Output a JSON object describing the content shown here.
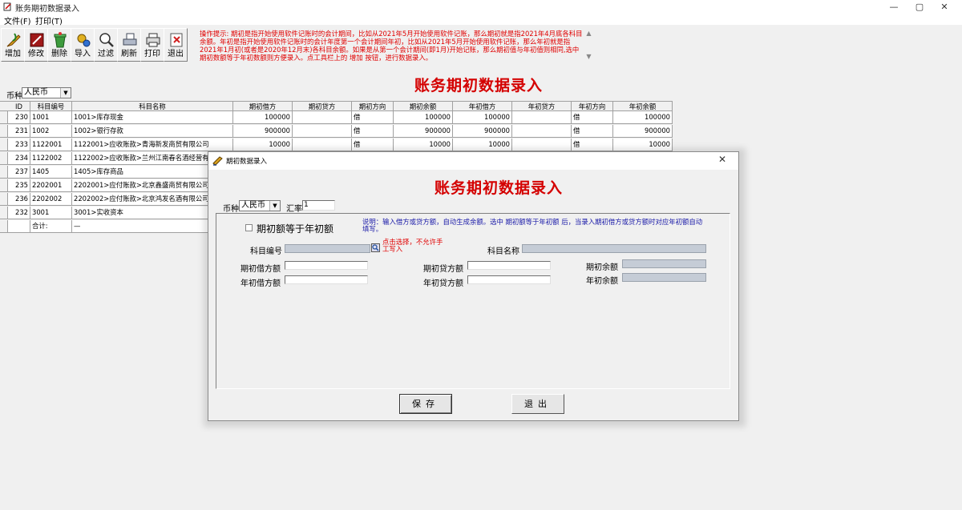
{
  "window": {
    "title": "账务期初数据录入",
    "controls": [
      "—",
      "▢",
      "✕"
    ]
  },
  "menu": [
    {
      "label": "文件(F)"
    },
    {
      "label": "打印(T)"
    }
  ],
  "toolbar": [
    {
      "label": "增加",
      "icon": "add-icon"
    },
    {
      "label": "修改",
      "icon": "edit-icon"
    },
    {
      "label": "删除",
      "icon": "delete-icon"
    },
    {
      "label": "导入",
      "icon": "import-icon"
    },
    {
      "label": "过滤",
      "icon": "filter-icon"
    },
    {
      "label": "刷新",
      "icon": "refresh-icon"
    },
    {
      "label": "打印",
      "icon": "print-icon"
    },
    {
      "label": "退出",
      "icon": "exit-icon"
    }
  ],
  "notice": "操作提示: 期初是指开始使用软件记账时的会计期间，比如从2021年5月开始使用软件记账，那么期初就是指2021年4月底各科目余额。年初是指开始使用软件记账时的会计年度第一个会计期间年初，比如从2021年5月开始使用软件记账，那么年初就是指2021年1月初(或者是2020年12月末)各科目余额。如果是从第一个会计期间(即1月)开始记账，那么期初值与年初值则相同,选中期初数额等于年初数额则方便录入。点工具栏上的 增加 按钮，进行数据录入。",
  "main_title": "账务期初数据录入",
  "currency": {
    "label": "币种",
    "value": "人民币"
  },
  "table": {
    "columns": [
      "ID",
      "科目编号",
      "科目名称",
      "期初借方",
      "期初贷方",
      "期初方向",
      "期初余额",
      "年初借方",
      "年初贷方",
      "年初方向",
      "年初余额"
    ],
    "rows": [
      [
        "230",
        "1001",
        "1001>库存现金",
        "100000",
        "",
        "借",
        "100000",
        "100000",
        "",
        "借",
        "100000"
      ],
      [
        "231",
        "1002",
        "1002>银行存款",
        "900000",
        "",
        "借",
        "900000",
        "900000",
        "",
        "借",
        "900000"
      ],
      [
        "233",
        "1122001",
        "1122001>应收账款>青海新发商贸有限公司",
        "10000",
        "",
        "借",
        "10000",
        "10000",
        "",
        "借",
        "10000"
      ],
      [
        "234",
        "1122002",
        "1122002>应收账款>兰州江南春名酒经营有限",
        "",
        "",
        "",
        "",
        "",
        "",
        "",
        ""
      ],
      [
        "237",
        "1405",
        "1405>库存商品",
        "",
        "",
        "",
        "",
        "",
        "",
        "",
        ""
      ],
      [
        "235",
        "2202001",
        "2202001>应付账款>北京鑫盛商贸有限公司",
        "",
        "",
        "",
        "",
        "",
        "",
        "",
        ""
      ],
      [
        "236",
        "2202002",
        "2202002>应付账款>北京鸿发名酒有限公司",
        "",
        "",
        "",
        "",
        "",
        "",
        "",
        ""
      ],
      [
        "232",
        "3001",
        "3001>实收资本",
        "",
        "",
        "",
        "",
        "",
        "",
        "",
        ""
      ],
      [
        "",
        "合计:",
        "—",
        "",
        "",
        "",
        "",
        "",
        "",
        "",
        ""
      ]
    ]
  },
  "dialog": {
    "title": "期初数据录入",
    "big_title": "账务期初数据录入",
    "currency_label": "币种",
    "currency_value": "人民币",
    "rate_label": "汇率",
    "rate_value": "1",
    "equal_checkbox": "期初额等于年初额",
    "note": "说明：输入借方或贷方额，自动生成余额。选中  期初额等于年初额  后，当录入期初借方或贷方额时对应年初额自动填写。",
    "acct_code_label": "科目编号",
    "hint": "点击选择，不允许手工写入",
    "acct_name_label": "科目名称",
    "begin_debit_label": "期初借方额",
    "begin_credit_label": "期初贷方额",
    "begin_balance_label": "期初余额",
    "year_debit_label": "年初借方额",
    "year_credit_label": "年初贷方额",
    "year_balance_label": "年初余额",
    "save_label": "保存",
    "exit_label": "退出"
  }
}
